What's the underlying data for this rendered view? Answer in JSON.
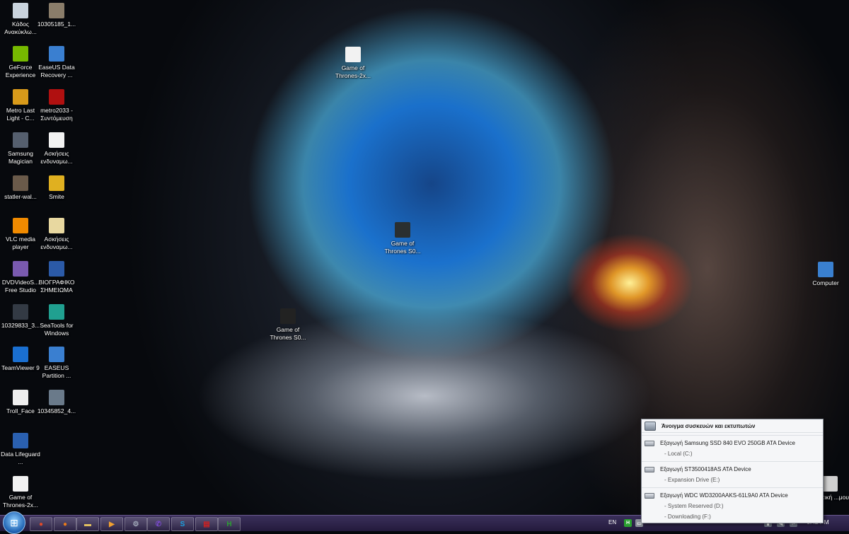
{
  "desktop": {
    "icons": [
      {
        "label": "Κάδος Ανακύκλω...",
        "icon": "recycle-bin-icon",
        "color": "#c9d3dd"
      },
      {
        "label": "10305185_1...",
        "icon": "image-file-icon",
        "color": "#8a7d6a"
      },
      {
        "label": "GeForce Experience",
        "icon": "geforce-icon",
        "color": "#76b900"
      },
      {
        "label": "EaseUS Data Recovery ...",
        "icon": "easeus-recovery-icon",
        "color": "#3a7fd0"
      },
      {
        "label": "Metro Last Light - C...",
        "icon": "metro-game-icon",
        "color": "#d89a1a"
      },
      {
        "label": "metro2033 - Συντόμευση",
        "icon": "metro2033-icon",
        "color": "#b01010"
      },
      {
        "label": "Samsung Magician",
        "icon": "samsung-magician-icon",
        "color": "#555f6e"
      },
      {
        "label": "Ασκήσεις ενδυναμω...",
        "icon": "document-icon",
        "color": "#f2f2f2"
      },
      {
        "label": "statler-wal...",
        "icon": "image-file-icon",
        "color": "#6a5a4a"
      },
      {
        "label": "Smite",
        "icon": "smite-icon",
        "color": "#e0b020"
      },
      {
        "label": "VLC media player",
        "icon": "vlc-icon",
        "color": "#f08a00"
      },
      {
        "label": "Ασκήσεις ενδυναμω...",
        "icon": "folder-doc-icon",
        "color": "#e8d8a0"
      },
      {
        "label": "DVDVideoS... Free Studio",
        "icon": "dvdvideosoft-icon",
        "color": "#7a5ab0"
      },
      {
        "label": "ΒΙΟΓΡΑΦΙΚΟ ΣΗΜΕΙΩΜΑ",
        "icon": "word-document-icon",
        "color": "#2b5aa8"
      },
      {
        "label": "10329833_3...",
        "icon": "image-file-icon",
        "color": "#333a44"
      },
      {
        "label": "SeaTools for Windows",
        "icon": "seatools-icon",
        "color": "#20a090"
      },
      {
        "label": "TeamViewer 9",
        "icon": "teamviewer-icon",
        "color": "#1a6fd0"
      },
      {
        "label": "EASEUS Partition ...",
        "icon": "easeus-partition-icon",
        "color": "#3a7fd0"
      },
      {
        "label": "Troll_Face",
        "icon": "image-file-icon",
        "color": "#eeeeee"
      },
      {
        "label": "10345852_4...",
        "icon": "image-file-icon",
        "color": "#6a7a8a"
      },
      {
        "label": "Data Lifeguard ...",
        "icon": "data-lifeguard-icon",
        "color": "#2a60b0"
      },
      {
        "label": "Game of Thrones-2x...",
        "icon": "document-icon",
        "color": "#f2f2f2"
      },
      {
        "label": "Game of Thrones-2x...",
        "icon": "document-icon",
        "color": "#f2f2f2"
      },
      {
        "label": "Game of Thrones S0...",
        "icon": "video-file-icon",
        "color": "#2a2f30"
      },
      {
        "label": "Game of Thrones S0...",
        "icon": "video-file-icon",
        "color": "#222222"
      },
      {
        "label": "Computer",
        "icon": "computer-icon",
        "color": "#3a80d0"
      },
      {
        "label": "...ηντική ...μου",
        "icon": "shortcut-icon",
        "color": "#d0d0d0"
      }
    ]
  },
  "taskbar": {
    "start_icon": "windows-start-icon",
    "pinned": [
      {
        "name": "chrome",
        "glyph": "●",
        "color": "#e04a2a"
      },
      {
        "name": "firefox",
        "glyph": "●",
        "color": "#e87a1a"
      },
      {
        "name": "explorer",
        "glyph": "▬",
        "color": "#e2c060"
      },
      {
        "name": "media-player",
        "glyph": "▶",
        "color": "#f0a030"
      },
      {
        "name": "steam",
        "glyph": "⚙",
        "color": "#a0a8b8"
      },
      {
        "name": "viber",
        "glyph": "✆",
        "color": "#7a4ad0"
      },
      {
        "name": "skype",
        "glyph": "S",
        "color": "#1aa0e0"
      },
      {
        "name": "pdf-reader",
        "glyph": "▤",
        "color": "#d02020"
      },
      {
        "name": "hwmonitor",
        "glyph": "H",
        "color": "#2aa030"
      }
    ],
    "language": "EN",
    "clock": "6:42 PM"
  },
  "eject_menu": {
    "header": "Άνοιγμα συσκευών και εκτυπωτών",
    "devices": [
      {
        "label": "Εξαγωγή Samsung SSD 840 EVO 250GB ATA Device",
        "volumes": [
          "-   Local (C:)"
        ]
      },
      {
        "label": "Εξαγωγή ST3500418AS ATA Device",
        "volumes": [
          "-   Expansion Drive (E:)"
        ]
      },
      {
        "label": "Εξαγωγή WDC WD3200AAKS-61L9A0 ATA Device",
        "volumes": [
          "-   System Reserved (D:)",
          "-   Downloading (F:)"
        ]
      }
    ]
  }
}
